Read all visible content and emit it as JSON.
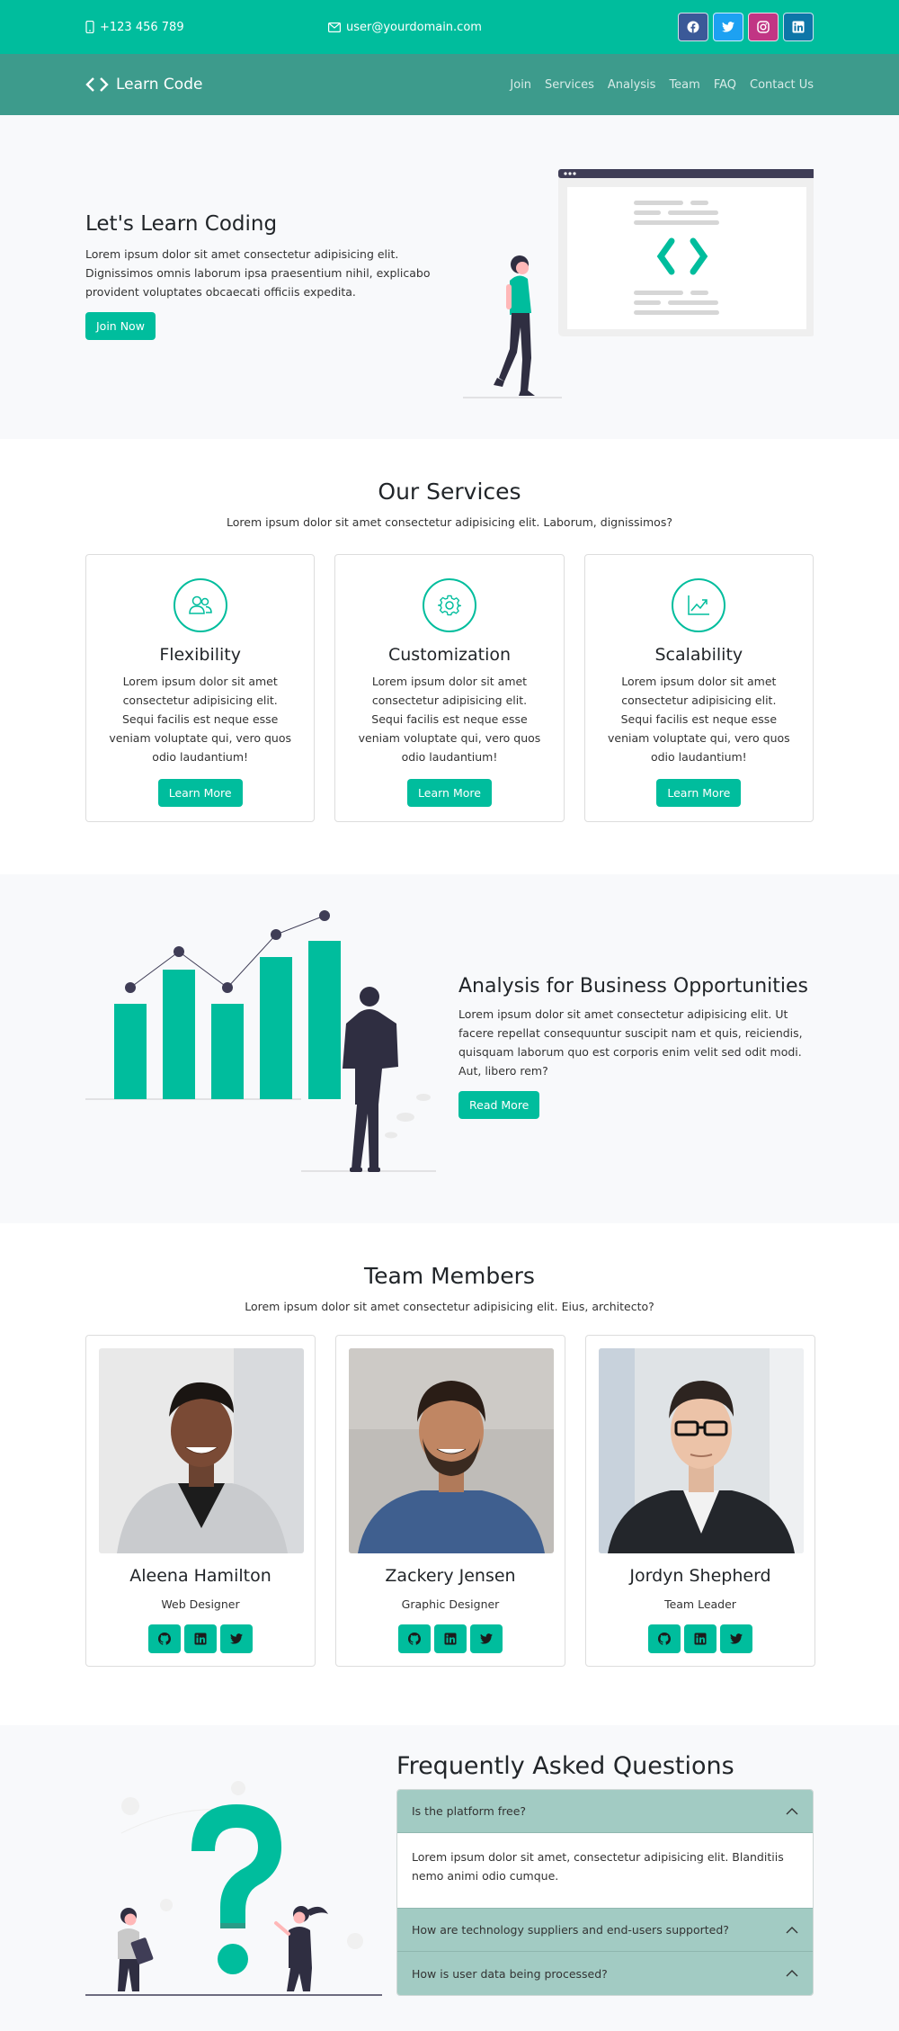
{
  "topbar": {
    "phone": "+123 456 789",
    "email": "user@yourdomain.com",
    "social_colors": {
      "facebook": "#3b5998",
      "twitter": "#1da1f2",
      "instagram": "#c13584",
      "linkedin": "#0e76a8"
    }
  },
  "nav": {
    "brand": "Learn Code",
    "links": [
      "Join",
      "Services",
      "Analysis",
      "Team",
      "FAQ",
      "Contact Us"
    ]
  },
  "hero": {
    "title": "Let's Learn Coding",
    "text": "Lorem ipsum dolor sit amet consectetur adipisicing elit. Dignissimos omnis laborum ipsa praesentium nihil, explicabo provident voluptates obcaecati officiis expedita.",
    "button": "Join Now"
  },
  "services": {
    "title": "Our Services",
    "subtitle": "Lorem ipsum dolor sit amet consectetur adipisicing elit. Laborum, dignissimos?",
    "items": [
      {
        "icon": "people-icon",
        "title": "Flexibility",
        "text": "Lorem ipsum dolor sit amet consectetur adipisicing elit. Sequi facilis est neque esse veniam voluptate qui, vero quos odio laudantium!",
        "button": "Learn More"
      },
      {
        "icon": "gear-icon",
        "title": "Customization",
        "text": "Lorem ipsum dolor sit amet consectetur adipisicing elit. Sequi facilis est neque esse veniam voluptate qui, vero quos odio laudantium!",
        "button": "Learn More"
      },
      {
        "icon": "graph-up-icon",
        "title": "Scalability",
        "text": "Lorem ipsum dolor sit amet consectetur adipisicing elit. Sequi facilis est neque esse veniam voluptate qui, vero quos odio laudantium!",
        "button": "Learn More"
      }
    ]
  },
  "analysis": {
    "title": "Analysis for Business Opportunities",
    "text": "Lorem ipsum dolor sit amet consectetur adipisicing elit. Ut facere repellat consequuntur suscipit nam et quis, reiciendis, quisquam laborum quo est corporis enim velit sed odit modi. Aut, libero rem?",
    "button": "Read More"
  },
  "team": {
    "title": "Team Members",
    "subtitle": "Lorem ipsum dolor sit amet consectetur adipisicing elit. Eius, architecto?",
    "members": [
      {
        "name": "Aleena Hamilton",
        "role": "Web Designer"
      },
      {
        "name": "Zackery Jensen",
        "role": "Graphic Designer"
      },
      {
        "name": "Jordyn Shepherd",
        "role": "Team Leader"
      }
    ]
  },
  "faq": {
    "title": "Frequently Asked Questions",
    "items": [
      {
        "q": "Is the platform free?",
        "a": "Lorem ipsum dolor sit amet, consectetur adipisicing elit. Blanditiis nemo animi odio cumque."
      },
      {
        "q": "How are technology suppliers and end-users supported?"
      },
      {
        "q": "How is user data being processed?"
      }
    ]
  },
  "accent": "#00bd9d"
}
